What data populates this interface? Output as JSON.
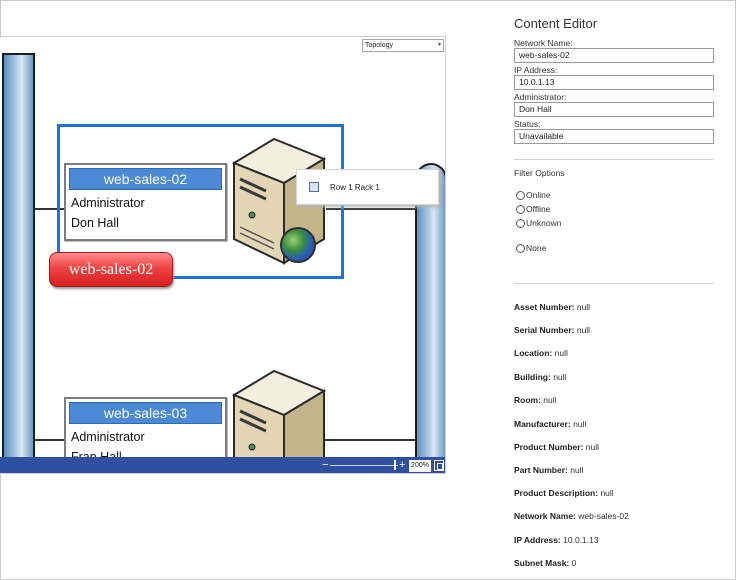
{
  "diagram": {
    "view_select": "Topology",
    "popup_text": "Row 1 Rack 1",
    "zoom_level": "200%",
    "nodes": [
      {
        "name": "web-sales-02",
        "role_label": "Administrator",
        "role_value": "Don Hall"
      },
      {
        "name": "web-sales-03",
        "role_label": "Administrator",
        "role_value": "Fran Hall"
      }
    ],
    "selected_badge": "web-sales-02",
    "colors": {
      "selection": "#1e73d8",
      "card_header": "#4a8ad7",
      "badge": "#e63b3b",
      "statusbar": "#2f4fa0"
    }
  },
  "editor": {
    "title": "Content Editor",
    "fields": [
      {
        "label": "Network Name:",
        "value": "web-sales-02"
      },
      {
        "label": "IP Address:",
        "value": "10.0.1.13"
      },
      {
        "label": "Administrator:",
        "value": "Don Hall"
      },
      {
        "label": "Status:",
        "value": "Unavailable"
      }
    ],
    "filter": {
      "title": "Filter Options",
      "options": [
        "Online",
        "Offline",
        "Unknown",
        "None"
      ]
    },
    "properties": [
      {
        "key": "Asset Number:",
        "value": "null"
      },
      {
        "key": "Serial Number:",
        "value": "null"
      },
      {
        "key": "Location:",
        "value": "null"
      },
      {
        "key": "Building:",
        "value": "null"
      },
      {
        "key": "Room:",
        "value": "null"
      },
      {
        "key": "Manufacturer:",
        "value": "null"
      },
      {
        "key": "Product Number:",
        "value": "null"
      },
      {
        "key": "Part Number:",
        "value": "null"
      },
      {
        "key": "Product Description:",
        "value": "null"
      },
      {
        "key": "Network Name:",
        "value": "web-sales-02"
      },
      {
        "key": "IP Address:",
        "value": "10.0.1.13"
      },
      {
        "key": "Subnet Mask:",
        "value": "0"
      }
    ]
  }
}
